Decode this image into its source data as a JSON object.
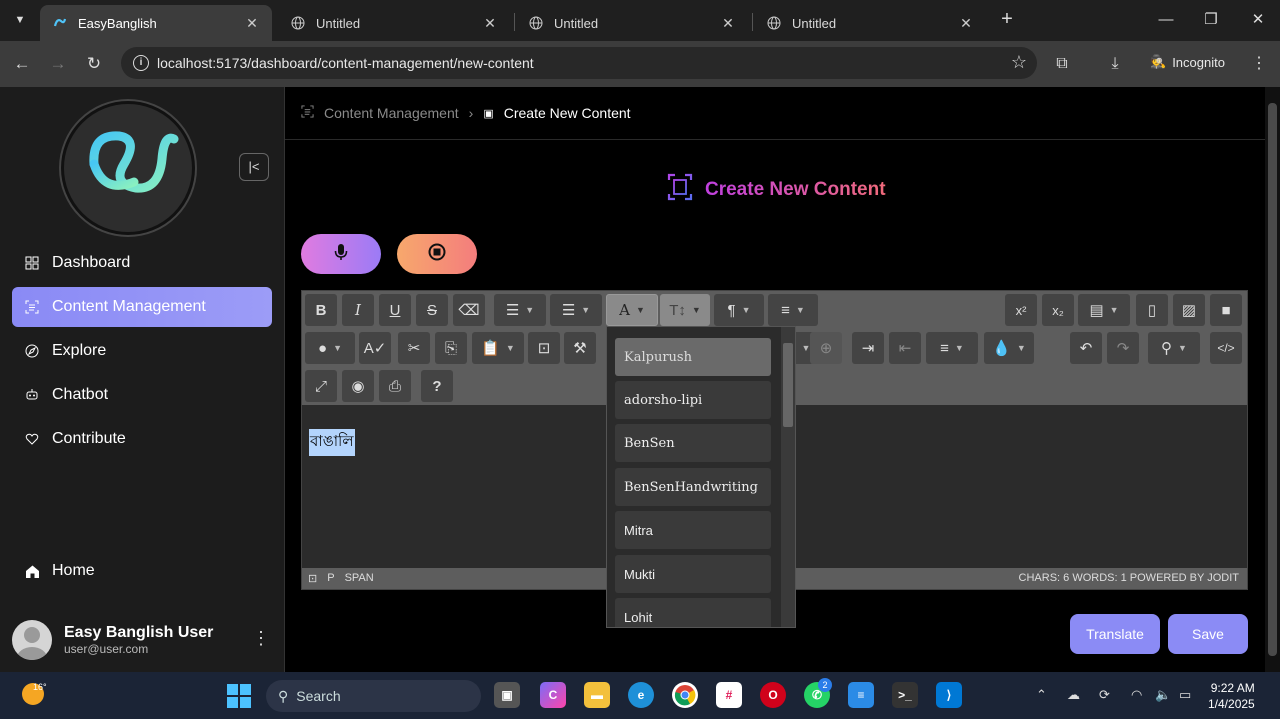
{
  "browser": {
    "tabs": [
      {
        "title": "EasyBanglish",
        "active": true
      },
      {
        "title": "Untitled",
        "active": false
      },
      {
        "title": "Untitled",
        "active": false
      },
      {
        "title": "Untitled",
        "active": false
      }
    ],
    "url": "localhost:5173/dashboard/content-management/new-content",
    "incognito_label": "Incognito"
  },
  "sidebar": {
    "items": [
      {
        "label": "Dashboard",
        "icon": "grid-icon"
      },
      {
        "label": "Content Management",
        "icon": "document-scan-icon",
        "active": true
      },
      {
        "label": "Explore",
        "icon": "compass-icon"
      },
      {
        "label": "Chatbot",
        "icon": "bot-icon"
      },
      {
        "label": "Contribute",
        "icon": "heart-hand-icon"
      }
    ],
    "home_label": "Home",
    "user": {
      "name": "Easy Banglish User",
      "email": "user@user.com"
    }
  },
  "breadcrumb": {
    "parent": "Content Management",
    "current": "Create New Content"
  },
  "page_title": "Create New Content",
  "editor": {
    "content": "বাঙালি",
    "status_left": [
      "P",
      "SPAN"
    ],
    "status_right": "CHARS: 6  WORDS: 1  POWERED BY JODIT"
  },
  "font_dropdown": {
    "options": [
      "Kalpurush",
      "adorsho-lipi",
      "BenSen",
      "BenSenHandwriting",
      "Mitra",
      "Mukti",
      "Lohit"
    ],
    "selected": "Kalpurush"
  },
  "actions": {
    "translate_label": "Translate",
    "save_label": "Save"
  },
  "taskbar": {
    "weather_temp": "16°",
    "search_placeholder": "Search",
    "whatsapp_badge": "2",
    "time": "9:22 AM",
    "date": "1/4/2025"
  },
  "colors": {
    "accent": "#8b8bf5",
    "mic_gradient": [
      "#e07be0",
      "#9b7bf6"
    ],
    "stop_gradient": [
      "#f7a86c",
      "#f47d7d"
    ]
  }
}
